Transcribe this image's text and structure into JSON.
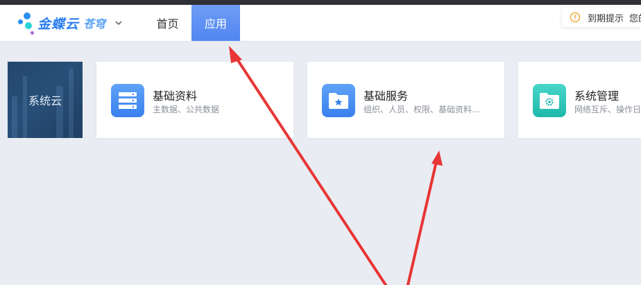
{
  "header": {
    "logo_text": "金蝶云",
    "logo_sub": "苍穹",
    "nav": [
      {
        "label": "首页",
        "active": false
      },
      {
        "label": "应用",
        "active": true
      }
    ],
    "notice": {
      "label": "到期提示",
      "truncated": "您的"
    }
  },
  "tile": {
    "label": "系统云"
  },
  "cards": [
    {
      "title": "基础资料",
      "desc": "主数据、公共数据",
      "icon": "server-stack-icon",
      "color": "#4a8ff4"
    },
    {
      "title": "基础服务",
      "desc": "组织、人员、权限、基础资料...",
      "icon": "folder-star-icon",
      "color": "#4a8ff4"
    },
    {
      "title": "系统管理",
      "desc": "网络互斥、操作日",
      "icon": "folder-gear-icon",
      "color": "#2ec3b6"
    }
  ],
  "colors": {
    "accent": "#5186f1",
    "arrow": "#e83535",
    "background": "#e9ecf2"
  }
}
